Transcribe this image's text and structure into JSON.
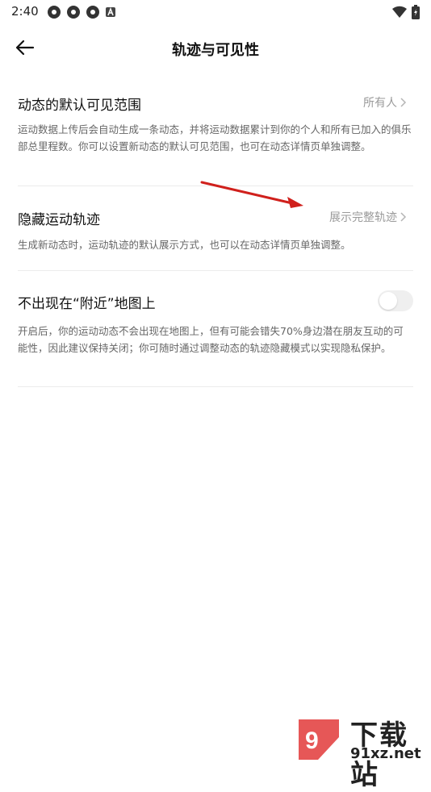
{
  "status_bar": {
    "time": "2:40"
  },
  "header": {
    "title": "轨迹与可见性"
  },
  "sections": [
    {
      "title": "动态的默认可见范围",
      "value": "所有人",
      "description": "运动数据上传后会自动生成一条动态，并将运动数据累计到你的个人和所有已加入的俱乐部总里程数。你可以设置新动态的默认可见范围，也可在动态详情页单独调整。"
    },
    {
      "title": "隐藏运动轨迹",
      "value": "展示完整轨迹",
      "description": "生成新动态时，运动轨迹的默认展示方式，也可以在动态详情页单独调整。"
    },
    {
      "title": "不出现在“附近”地图上",
      "toggle_on": false,
      "description": "开启后，你的运动动态不会出现在地图上，但有可能会错失70%身边潜在朋友互动的可能性，因此建议保持关闭；你可随时通过调整动态的轨迹隐藏模式以实现隐私保护。"
    }
  ],
  "watermark": {
    "line1": "下载站",
    "line2": "91xz.net"
  },
  "colors": {
    "annotation_arrow": "#d0201c",
    "toggle_off": "#efefef",
    "secondary_text": "#9a9a9a"
  }
}
